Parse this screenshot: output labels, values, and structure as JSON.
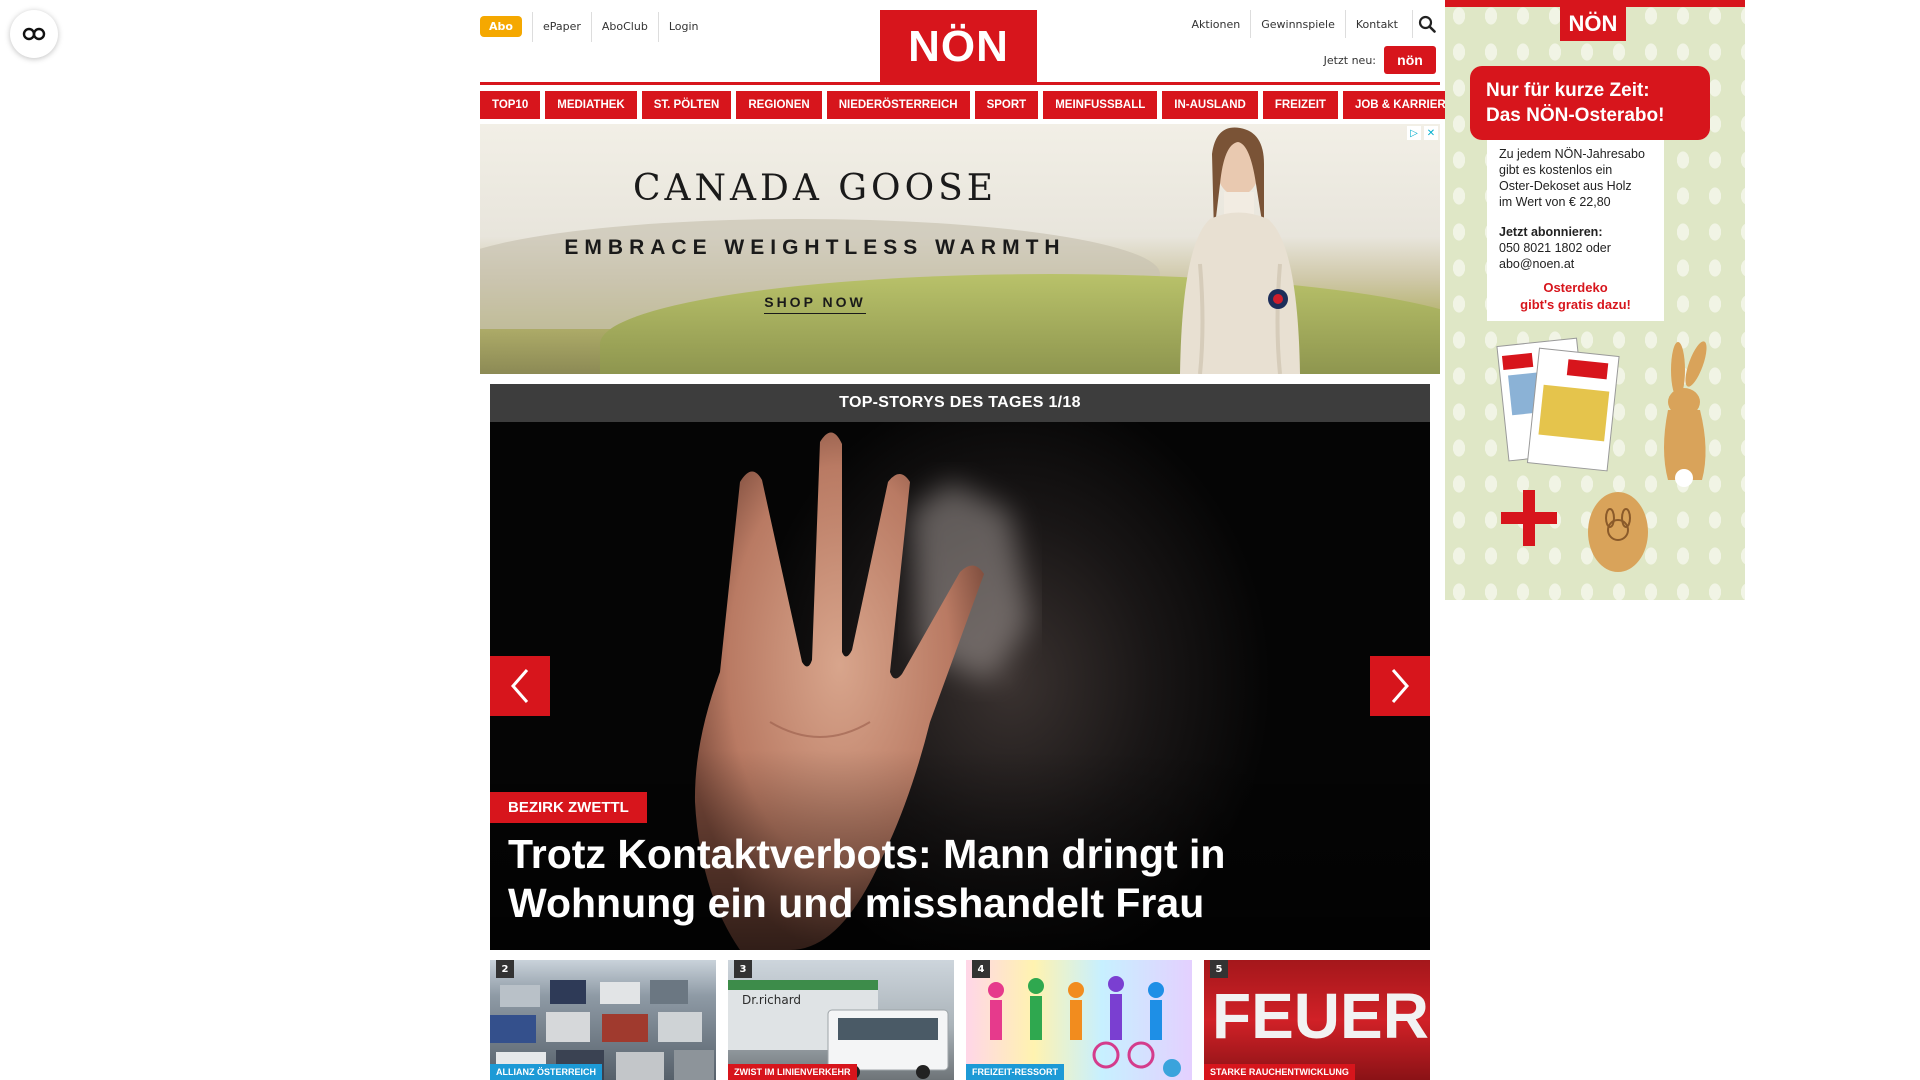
{
  "header": {
    "abo_label": "Abo",
    "links_left": [
      "ePaper",
      "AboClub",
      "Login"
    ],
    "logo_text": "NÖN",
    "links_right": [
      "Aktionen",
      "Gewinnspiele",
      "Kontakt"
    ],
    "jetzt_neu_label": "Jetzt neu:",
    "jetzt_badge_text": "nön"
  },
  "nav": {
    "items": [
      "TOP10",
      "MEDIATHEK",
      "ST. PÖLTEN",
      "REGIONEN",
      "NIEDERÖSTERREICH",
      "SPORT",
      "MEINFUSSBALL",
      "IN-AUSLAND",
      "FREIZEIT",
      "JOB & KARRIERE"
    ]
  },
  "ad_banner": {
    "brand": "CANADA GOOSE",
    "tagline": "EMBRACE WEIGHTLESS WARMTH",
    "cta": "SHOP NOW"
  },
  "stories": {
    "header": "TOP-STORYS DES TAGES 1/18",
    "category": "BEZIRK ZWETTL",
    "title": "Trotz Kontaktverbots: Mann dringt in Wohnung ein und misshandelt Frau",
    "thumbs": [
      {
        "num": "2",
        "label": "ALLIANZ ÖSTERREICH",
        "blue": false
      },
      {
        "num": "3",
        "label": "ZWIST IM LINIENVERKEHR",
        "blue": false
      },
      {
        "num": "4",
        "label": "FREIZEIT-RESSORT",
        "blue": true
      },
      {
        "num": "5",
        "label": "STARKE RAUCHENTWICKLUNG",
        "blue": false
      }
    ]
  },
  "side_ad": {
    "logo": "NÖN",
    "headline_1": "Nur für kurze Zeit:",
    "headline_2": "Das NÖN-Osterabo!",
    "line1": "Zu jedem NÖN-Jahresabo",
    "line2": "gibt es kostenlos ein",
    "line3": "Oster-Dekoset aus Holz",
    "line4": "im Wert von € 22,80",
    "subscribe_label": "Jetzt abonnieren:",
    "phone": "050 8021 1802 oder",
    "email": "abo@noen.at",
    "deko_1": "Osterdeko",
    "deko_2": "gibt's gratis dazu!"
  }
}
